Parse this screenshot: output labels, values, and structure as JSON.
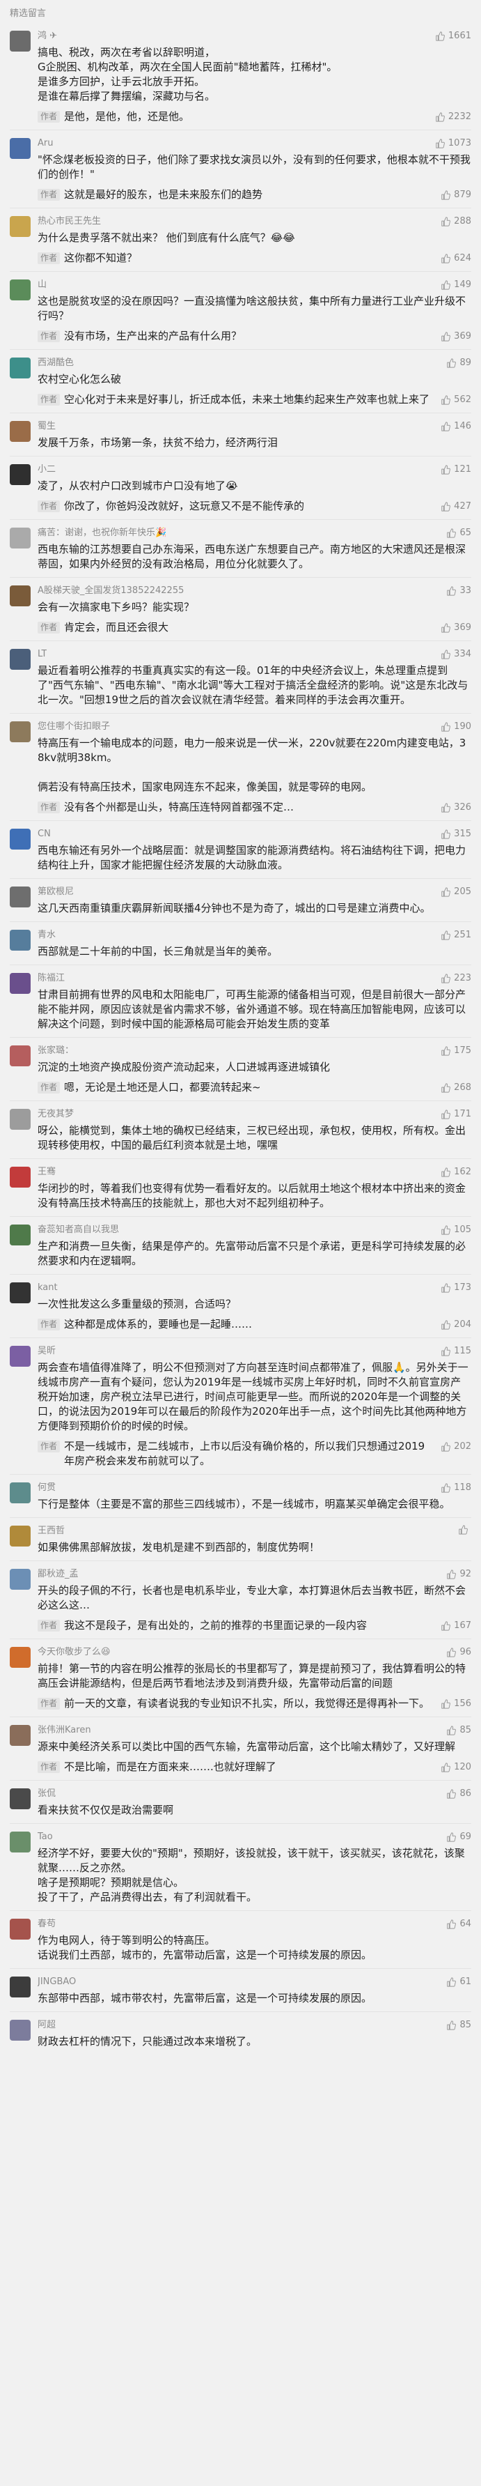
{
  "section_title": "精选留言",
  "comments": [
    {
      "name": "鸿 ✈",
      "likes": "1661",
      "avatar_color": "#6b6b6b",
      "text": "搞电、税改，两次在考省以辞职明道，\nG企脱困、机构改革，两次在全国人民面前\"糙地蓄阵，扛稀材\"。\n是谁多方回护，让手云北放手开拓。\n是谁在幕后撑了舞摆编，深藏功与名。",
      "reply": "是他，是他，他，还是他。",
      "reply_likes": "2232"
    },
    {
      "name": "Aru",
      "likes": "1073",
      "avatar_color": "#4a6da7",
      "text": "\"怀念煤老板投资的日子，他们除了要求找女演员以外，没有到的任何要求，他根本就不干预我们的创作！\"",
      "reply": "这就是最好的股东，也是未来股东们的趋势",
      "reply_likes": "879"
    },
    {
      "name": "热心市民王先生",
      "likes": "288",
      "avatar_color": "#c9a54d",
      "text": "为什么是贵孚落不就出来？ 他们到底有什么底气？😂😂",
      "reply": "这你都不知道？",
      "reply_likes": "624"
    },
    {
      "name": "山",
      "likes": "149",
      "avatar_color": "#5b8c5a",
      "text": "这也是脱贫攻坚的没在原因吗？一直没搞懂为啥这般扶贫，集中所有力量进行工业产业升级不行吗？",
      "reply": "没有市场，生产出来的产品有什么用？",
      "reply_likes": "369"
    },
    {
      "name": "西湖酷色",
      "likes": "89",
      "avatar_color": "#3d8f8a",
      "text": "农村空心化怎么破",
      "reply": "空心化对于未来是好事儿，折迁成本低，未来土地集约起来生产效率也就上来了",
      "reply_likes": "562"
    },
    {
      "name": "蜀生",
      "likes": "146",
      "avatar_color": "#9a6c48",
      "text": "发展千万条，市场第一条，扶贫不给力，经济两行泪",
      "reply": "",
      "reply_likes": ""
    },
    {
      "name": "小二",
      "likes": "121",
      "avatar_color": "#2f2f2f",
      "text": "凌了，从农村户口改到城市户口没有地了😭",
      "reply": "你改了，你爸妈没改就好，这玩意又不是不能传承的",
      "reply_likes": "427"
    },
    {
      "name": "痛苦：谢谢，也祝你新年快乐🎉",
      "likes": "65",
      "avatar_color": "#aaaaaa",
      "text": "西电东输的江苏想要自己办东海采，西电东送广东想要自己产。南方地区的大宋遗风还是根深蒂固，如果内外经贸的没有政治格局，用位分化就要久了。",
      "reply": "",
      "reply_likes": ""
    },
    {
      "name": "A股梯天驶_全国发货13852242255",
      "likes": "33",
      "avatar_color": "#7a5b3a",
      "text": "会有一次搞家电下乡吗？能实现？",
      "reply": "肯定会，而且还会很大",
      "reply_likes": "369"
    },
    {
      "name": "LT",
      "likes": "334",
      "avatar_color": "#4b5f7a",
      "text": "最近看着明公推荐的书重真真实实的有这一段。01年的中央经济会议上，朱总理重点提到了\"西气东输\"、\"西电东输\"、\"南水北调\"等大工程对于搞活全盘经济的影响。说\"这是东北改与北一次。\"回想19世之后的首次会议就在清华经营。着来同样的手法会再次重开。",
      "reply": "",
      "reply_likes": ""
    },
    {
      "name": "您住哪个街扣眼子",
      "likes": "190",
      "avatar_color": "#8d7a5c",
      "text": "特高压有一个输电成本的问题，电力一般来说是一伏一米，220v就要在220m内建变电站，38kv就明38km。\n\n俩若没有特高压技术，国家电网连东不起来，像美国，就是零碎的电网。",
      "reply": "没有各个州都是山头，特高压连特网首都强不定…",
      "reply_likes": "326"
    },
    {
      "name": "CN",
      "likes": "315",
      "avatar_color": "#3f6fb6",
      "text": "西电东输还有另外一个战略层面：就是调整国家的能源消费结构。将石油结构往下调，把电力结构往上升，国家才能把握住经济发展的大动脉血液。",
      "reply": "",
      "reply_likes": ""
    },
    {
      "name": "第欧根尼",
      "likes": "205",
      "avatar_color": "#6e6e6e",
      "text": "这几天西南重镇重庆霸屏新闻联播4分钟也不是为奇了，城出的口号是建立消费中心。",
      "reply": "",
      "reply_likes": ""
    },
    {
      "name": "青水",
      "likes": "251",
      "avatar_color": "#567d9c",
      "text": "西部就是二十年前的中国，长三角就是当年的美帝。",
      "reply": "",
      "reply_likes": ""
    },
    {
      "name": "陈福江",
      "likes": "223",
      "avatar_color": "#6a4f8c",
      "text": "甘肃目前拥有世界的风电和太阳能电厂，可再生能源的储备相当可观，但是目前很大一部分产能不能并网，原因应该就是省内需求不够，省外通道不够。现在特高压加智能电网，应该可以解决这个问题，到时候中国的能源格局可能会开始发生质的变革",
      "reply": "",
      "reply_likes": ""
    },
    {
      "name": "张家璐：",
      "likes": "175",
      "avatar_color": "#b55e5e",
      "text": "沉淀的土地资产换成股份资产流动起来，人口进城再逐进城镇化",
      "reply": "嗯，无论是土地还是人口，都要流转起来~",
      "reply_likes": "268"
    },
    {
      "name": "无夜其梦",
      "likes": "171",
      "avatar_color": "#9c9c9c",
      "text": "呀公，能横觉到，集体土地的确权已经结束，三权已经出现，承包权，使用权，所有权。金出现转移使用权，中国的最后红利资本就是土地，嘿嘿",
      "reply": "",
      "reply_likes": ""
    },
    {
      "name": "王骞",
      "likes": "162",
      "avatar_color": "#c23b3b",
      "text": "华闭抄的时，等着我们也变得有优势一看看好友的。以后就用土地这个根材本中挤出来的资金没有特高压技术特高压的技能就上，那也大对不起列组初种子。",
      "reply": "",
      "reply_likes": ""
    },
    {
      "name": "奋蕊知者高自以我思",
      "likes": "105",
      "avatar_color": "#4f7a4a",
      "text": "生产和消费一旦失衡，结果是停产的。先富带动后富不只是个承诺，更是科学可持续发展的必然要求和内在逻辑啊。",
      "reply": "",
      "reply_likes": ""
    },
    {
      "name": "kant",
      "likes": "173",
      "avatar_color": "#333333",
      "text": "一次性批发这么多重量级的预测，合适吗？",
      "reply": "这种都是成体系的，要睡也是一起睡……",
      "reply_likes": "204"
    },
    {
      "name": "吴昕",
      "likes": "115",
      "avatar_color": "#7b5fa3",
      "text": "两会查布墙值得准降了，明公不但预测对了方向甚至连时间点都带准了，佩服🙏。另外关于一线城市房产一直有个疑问，您认为2019年是一线城市买房上年好时机，同时不久前官宣房产税开始加速，房产税立法早已进行，时间点可能更早一些。而所说的2020年是一个调整的关口，的说法因为2019年可以在最后的阶段作为2020年出手一点，这个时间先比其他两种地方方便降到预期价价的时候的时候。",
      "reply": "不是一线城市，是二线城市，上市以后没有确价格的，所以我们只想通过2019年房产税会来发布前就可以了。",
      "reply_likes": "202"
    },
    {
      "name": "何贯",
      "likes": "118",
      "avatar_color": "#5d8c8c",
      "text": "下行是整体（主要是不富的那些三四线城市），不是一线城市，明嘉某买单确定会很平稳。",
      "reply": "",
      "reply_likes": ""
    },
    {
      "name": "王西哲",
      "likes": "",
      "avatar_color": "#b08a3a",
      "text": "如果佛佛黑部解放拔，发电机是建不到西部的，制度优势啊！",
      "reply": "",
      "reply_likes": ""
    },
    {
      "name": "鄙秋迹_孟",
      "likes": "92",
      "avatar_color": "#6c8fb5",
      "text": "开头的段子佩的不行，长者也是电机系毕业，专业大拿，本打算退休后去当教书匠，断然不会必这么这…",
      "reply": "我这不是段子，是有出处的，之前的推荐的书里面记录的一段内容",
      "reply_likes": "167"
    },
    {
      "name": "今天你敬步了么😆",
      "likes": "96",
      "avatar_color": "#d06c2c",
      "text": "前排！第一节的内容在明公推荐的张局长的书里都写了，算是提前预习了，我估算看明公的特高压会讲能源结构，但是后两节看地法涉及到消费升级，先富带动后富的间题",
      "reply": "前一天的文章，有读者说我的专业知识不扎实，所以，我觉得还是得再补一下。",
      "reply_likes": "156"
    },
    {
      "name": "张伟洲Karen",
      "likes": "85",
      "avatar_color": "#8a6d5a",
      "text": "源来中美经济关系可以类比中国的西气东输，先富带动后富，这个比喻太精妙了，又好理解",
      "reply": "不是比喻，而是在方面来来…….也就好理解了",
      "reply_likes": "120"
    },
    {
      "name": "张侃",
      "likes": "86",
      "avatar_color": "#4a4a4a",
      "text": "看来扶贫不仅仅是政治需要啊",
      "reply": "",
      "reply_likes": ""
    },
    {
      "name": "Tao",
      "likes": "69",
      "avatar_color": "#6a8f6a",
      "text": "经济学不好，要要大伙的\"预期\"，预期好，该投就投，该干就干，该买就买，该花就花，该聚就聚……反之亦然。\n啥子是预期呢？预期就是信心。\n投了干了，产品消费得出去，有了利润就看干。",
      "reply": "",
      "reply_likes": ""
    },
    {
      "name": "春苟",
      "likes": "64",
      "avatar_color": "#a5534c",
      "text": "作为电网人，待于等到明公的特高压。\n话说我们土西部，城市的，先富带动后富，这是一个可持续发展的原因。",
      "reply": "",
      "reply_likes": ""
    },
    {
      "name": "JINGBAO",
      "likes": "61",
      "avatar_color": "#3c3c3c",
      "text": "东部带中西部，城市带农村，先富带后富，这是一个可持续发展的原因。",
      "reply": "",
      "reply_likes": ""
    },
    {
      "name": "阿超",
      "likes": "85",
      "avatar_color": "#7c7c9c",
      "text": "财政去杠杆的情况下，只能通过改本来增税了。",
      "reply": "",
      "reply_likes": ""
    }
  ],
  "labels": {
    "author": "作者"
  }
}
